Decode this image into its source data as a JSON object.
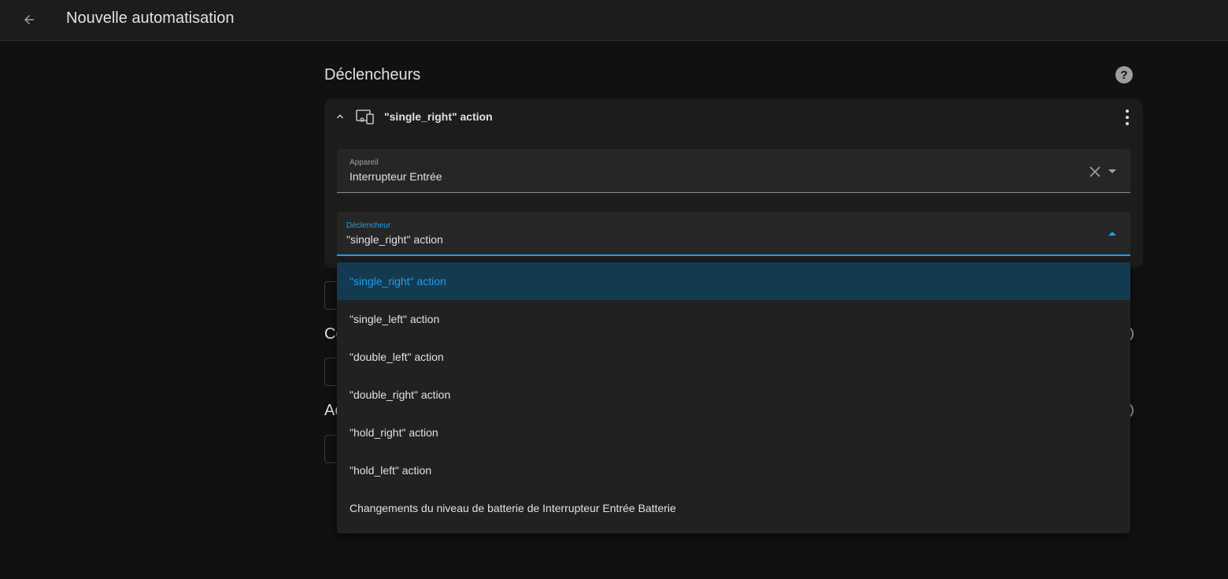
{
  "header": {
    "title": "Nouvelle automatisation"
  },
  "triggers_section": {
    "title": "Déclencheurs",
    "card": {
      "title": "\"single_right\" action",
      "device_field": {
        "label": "Appareil",
        "value": "Interrupteur Entrée"
      },
      "trigger_field": {
        "label": "Déclencheur",
        "value": "\"single_right\" action"
      }
    }
  },
  "partial_sections": {
    "conditions_initial": "Co",
    "actions_initial": "Ac"
  },
  "dropdown": {
    "options": [
      "\"single_right\" action",
      "\"single_left\" action",
      "\"double_left\" action",
      "\"double_right\" action",
      "\"hold_right\" action",
      "\"hold_left\" action",
      "Changements du niveau de batterie de Interrupteur Entrée Batterie"
    ],
    "selected_index": 0
  },
  "colors": {
    "accent": "#1ea0e4",
    "background": "#111111",
    "card": "#1c1c1c",
    "selected_row": "#143a52"
  },
  "icons": {
    "back": "arrow-left-icon",
    "help": "help-circle-icon",
    "collapse": "chevron-up-icon",
    "device": "devices-icon",
    "menu": "dots-vertical-icon",
    "clear": "close-icon",
    "dropdown": "menu-down-icon"
  }
}
